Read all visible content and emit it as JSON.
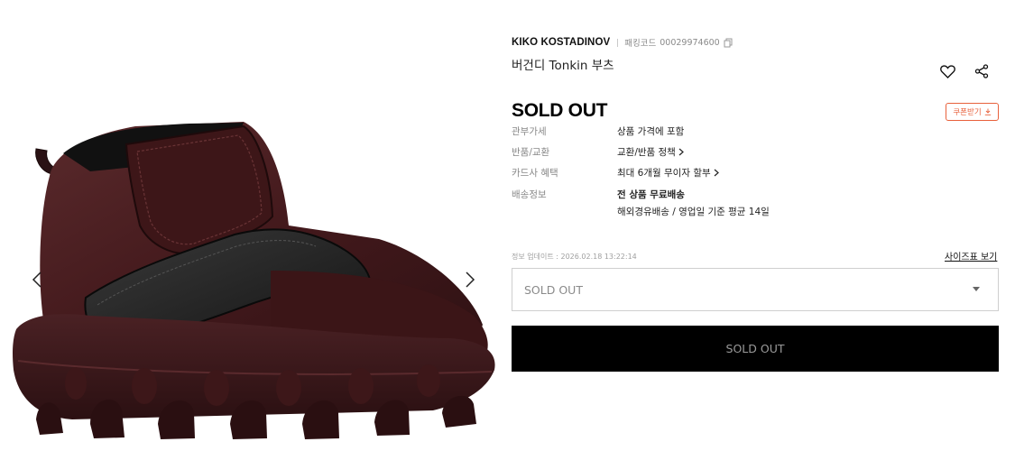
{
  "gallery": {
    "image_alt": "버건디 Tonkin 부츠",
    "prev_icon": "chevron-left-icon",
    "next_icon": "chevron-right-icon"
  },
  "product": {
    "brand": "KIKO KOSTADINOV",
    "code_label": "패킹코드",
    "code_value": "00029974600",
    "title": "버건디 Tonkin 부츠",
    "status": "SOLD OUT",
    "coupon_label": "쿠폰받기"
  },
  "specs": [
    {
      "label": "관부가세",
      "value": "상품 가격에 포함"
    },
    {
      "label": "반품/교환",
      "value": "교환/반품 정책"
    },
    {
      "label": "카드사 혜택",
      "value": "최대 6개월 무이자 할부"
    },
    {
      "label": "배송정보",
      "value": "전 상품 무료배송",
      "value2": "해외경유배송 / 영업일 기준 평균 14일"
    }
  ],
  "meta": {
    "updated": "정보 업데이트 : 2026.02.18 13:22:14",
    "size_chart": "사이즈표 보기"
  },
  "option_select": {
    "value": "SOLD OUT"
  },
  "buy_button": {
    "label": "SOLD OUT"
  },
  "colors": {
    "accent": "#e8613c",
    "boot_leather": "#4a1f21",
    "boot_black": "#1c1c1c",
    "button_bg": "#000000"
  }
}
